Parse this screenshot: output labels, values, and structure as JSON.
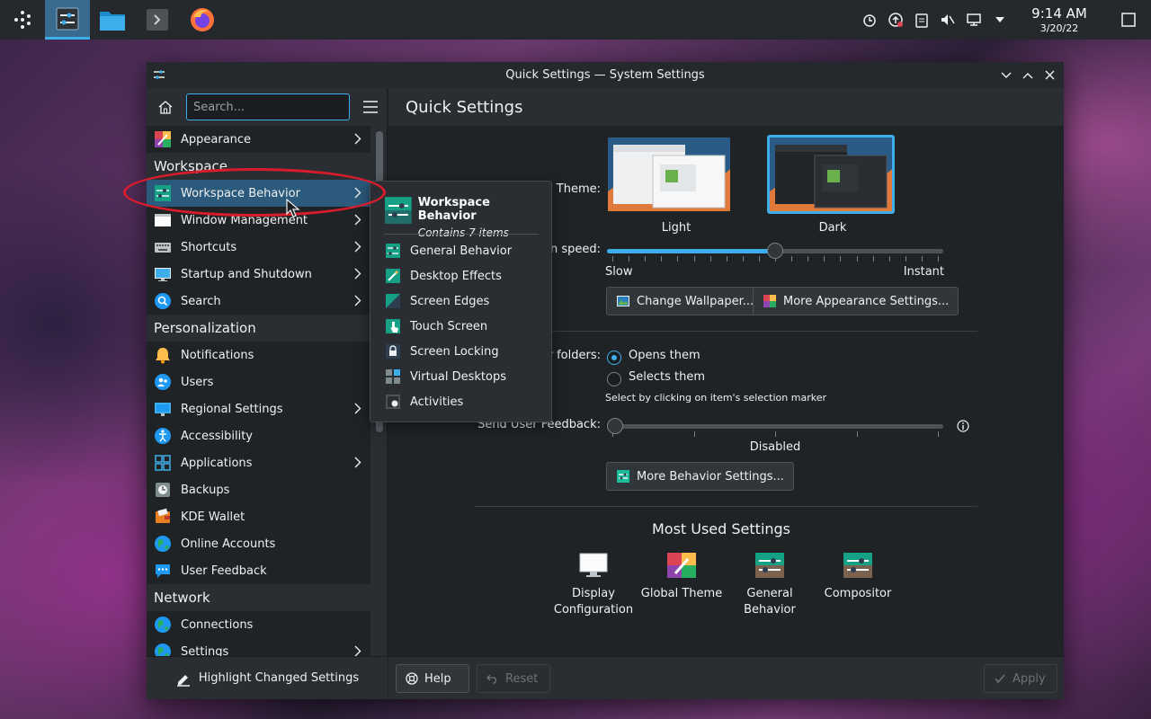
{
  "panel": {
    "launcher_icon": "kde-launcher-icon",
    "tasks": [
      {
        "name": "system-settings-task",
        "icon": "settings-icon",
        "active": true
      },
      {
        "name": "file-manager-task",
        "icon": "folder-icon",
        "active": false
      },
      {
        "name": "terminal-task",
        "icon": "terminal-icon",
        "active": false
      },
      {
        "name": "firefox-task",
        "icon": "firefox-icon",
        "active": false
      }
    ],
    "clock": {
      "time": "9:14 AM",
      "date": "3/20/22"
    }
  },
  "window": {
    "title": "Quick Settings — System Settings"
  },
  "sidebar": {
    "search_placeholder": "Search...",
    "items": [
      {
        "type": "item",
        "label": "Appearance",
        "icon": "appearance-icon",
        "chevron": true
      },
      {
        "type": "category",
        "label": "Workspace"
      },
      {
        "type": "item",
        "label": "Workspace Behavior",
        "icon": "workspace-behavior-icon",
        "chevron": true,
        "selected": true
      },
      {
        "type": "item",
        "label": "Window Management",
        "icon": "window-management-icon",
        "chevron": true
      },
      {
        "type": "item",
        "label": "Shortcuts",
        "icon": "keyboard-icon",
        "chevron": true
      },
      {
        "type": "item",
        "label": "Startup and Shutdown",
        "icon": "startup-icon",
        "chevron": true
      },
      {
        "type": "item",
        "label": "Search",
        "icon": "search-icon",
        "chevron": true
      },
      {
        "type": "category",
        "label": "Personalization"
      },
      {
        "type": "item",
        "label": "Notifications",
        "icon": "bell-icon",
        "chevron": false
      },
      {
        "type": "item",
        "label": "Users",
        "icon": "users-icon",
        "chevron": false
      },
      {
        "type": "item",
        "label": "Regional Settings",
        "icon": "regional-icon",
        "chevron": true
      },
      {
        "type": "item",
        "label": "Accessibility",
        "icon": "accessibility-icon",
        "chevron": false
      },
      {
        "type": "item",
        "label": "Applications",
        "icon": "applications-icon",
        "chevron": true
      },
      {
        "type": "item",
        "label": "Backups",
        "icon": "backups-icon",
        "chevron": false
      },
      {
        "type": "item",
        "label": "KDE Wallet",
        "icon": "wallet-icon",
        "chevron": false
      },
      {
        "type": "item",
        "label": "Online Accounts",
        "icon": "globe-icon",
        "chevron": false
      },
      {
        "type": "item",
        "label": "User Feedback",
        "icon": "feedback-icon",
        "chevron": false
      },
      {
        "type": "category",
        "label": "Network"
      },
      {
        "type": "item",
        "label": "Connections",
        "icon": "globe-icon",
        "chevron": false
      },
      {
        "type": "item",
        "label": "Settings",
        "icon": "globe-icon",
        "chevron": true
      }
    ],
    "footer_label": "Highlight Changed Settings"
  },
  "main": {
    "title": "Quick Settings",
    "theme_label": "Theme:",
    "themes": [
      {
        "label": "Light",
        "selected": false
      },
      {
        "label": "Dark",
        "selected": true
      }
    ],
    "animation_label": "on speed:",
    "animation_speed_fraction": 0.5,
    "slow_label": "Slow",
    "instant_label": "Instant",
    "change_wallpaper_label": "Change Wallpaper...",
    "more_appearance_label": "More Appearance Settings...",
    "folders_label": "r folders:",
    "opens_label": "Opens them",
    "selects_label": "Selects them",
    "select_hint": "Select by clicking on item's selection marker",
    "feedback_label": "Send User Feedback:",
    "feedback_value_label": "Disabled",
    "feedback_level_fraction": 0,
    "more_behavior_label": "More Behavior Settings...",
    "most_used_title": "Most Used Settings",
    "most_used": [
      {
        "line1": "Display",
        "line2": "Configuration",
        "icon": "display-icon"
      },
      {
        "line1": "Global Theme",
        "line2": "",
        "icon": "global-theme-icon"
      },
      {
        "line1": "General",
        "line2": "Behavior",
        "icon": "general-behavior-icon"
      },
      {
        "line1": "Compositor",
        "line2": "",
        "icon": "compositor-icon"
      }
    ],
    "help_label": "Help",
    "reset_label": "Reset",
    "apply_label": "Apply"
  },
  "popup": {
    "title": "Workspace Behavior",
    "subtitle": "Contains 7 items",
    "items": [
      "General Behavior",
      "Desktop Effects",
      "Screen Edges",
      "Touch Screen",
      "Screen Locking",
      "Virtual Desktops",
      "Activities"
    ]
  },
  "colors": {
    "accent": "#3daee9",
    "annotation": "#d91c2b",
    "window_bg": "#202326",
    "panel_bg": "#25282c"
  }
}
